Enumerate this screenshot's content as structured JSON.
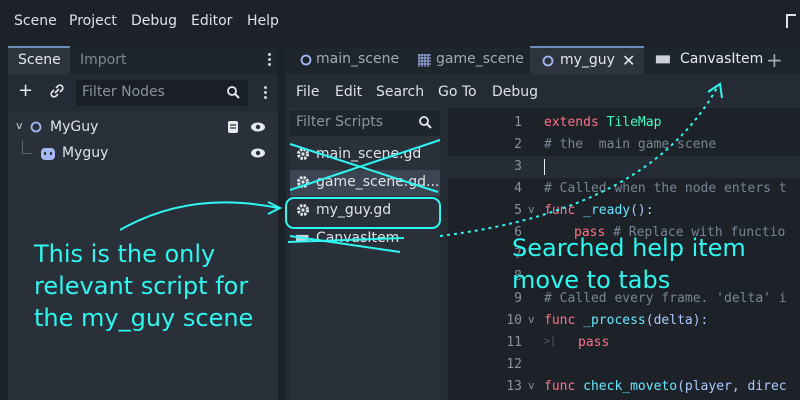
{
  "menubar": {
    "items": [
      "Scene",
      "Project",
      "Debug",
      "Editor",
      "Help"
    ]
  },
  "scene_dock": {
    "tabs": [
      "Scene",
      "Import"
    ],
    "filter_placeholder": "Filter Nodes",
    "tree": [
      {
        "label": "MyGuy",
        "icon": "node-circle-icon"
      },
      {
        "label": "Myguy",
        "icon": "sprite-face-icon"
      }
    ]
  },
  "editor": {
    "tabs": [
      "main_scene",
      "game_scene",
      "my_guy",
      "CanvasItem"
    ],
    "menu": [
      "File",
      "Edit",
      "Search",
      "Go To",
      "Debug"
    ],
    "filter_scripts_placeholder": "Filter Scripts",
    "scripts": [
      "main_scene.gd",
      "game_scene.gd...",
      "my_guy.gd",
      "CanvasItem"
    ],
    "code_lines": [
      {
        "n": "1",
        "fold": ""
      },
      {
        "n": "2",
        "fold": ""
      },
      {
        "n": "3",
        "fold": ""
      },
      {
        "n": "4",
        "fold": ""
      },
      {
        "n": "5",
        "fold": "v"
      },
      {
        "n": "6",
        "fold": ""
      },
      {
        "n": "7",
        "fold": ""
      },
      {
        "n": "8",
        "fold": ""
      },
      {
        "n": "9",
        "fold": ""
      },
      {
        "n": "10",
        "fold": "v"
      },
      {
        "n": "11",
        "fold": ""
      },
      {
        "n": "12",
        "fold": ""
      },
      {
        "n": "13",
        "fold": "v"
      }
    ],
    "code": {
      "l1_kw": "extends",
      "l1_cls": "TileMap",
      "l2": "# the  main game scene",
      "l4": "# Called when the node enters t",
      "l5_kw": "func",
      "l5_fn": "_ready",
      "l5_rest": "():",
      "l6_kw": "pass",
      "l6_cm": "# Replace with functio",
      "l9": "# Called every frame. 'delta' i",
      "l10_kw": "func",
      "l10_fn": "_process",
      "l10_rest": "(delta):",
      "l11_kw": "pass",
      "l13_kw": "func",
      "l13_fn": "check_moveto",
      "l13_rest": "(player, direc"
    }
  },
  "annotations": {
    "left_note": [
      "This is the only",
      "relevant script for",
      "the my_guy scene"
    ],
    "right_note": [
      "Searched help item",
      "move to tabs"
    ]
  },
  "colors": {
    "annotation": "#2ff7ef",
    "accent": "#6d8cb8"
  }
}
